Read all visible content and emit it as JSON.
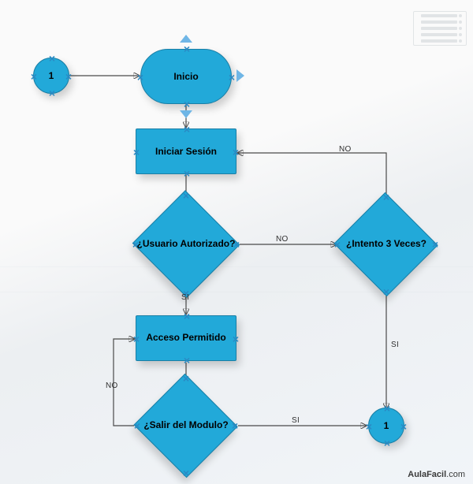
{
  "colors": {
    "shape_fill": "#22a9d9",
    "shape_stroke": "#1a7fa6",
    "arrow": "#4a4a4a",
    "handle": "#2a8ac4"
  },
  "selected_node": "inicio",
  "nodes": {
    "conn_in": {
      "type": "connector-circle",
      "label": "1"
    },
    "inicio": {
      "type": "terminator",
      "label": "Inicio"
    },
    "login": {
      "type": "process",
      "label": "Iniciar Sesión"
    },
    "auth": {
      "type": "decision",
      "label": "¿Usuario Autorizado?"
    },
    "retry": {
      "type": "decision",
      "label": "¿Intento 3 Veces?"
    },
    "allowed": {
      "type": "process",
      "label": "Acceso Permitido"
    },
    "exitq": {
      "type": "decision",
      "label": "¿Salir del Modulo?"
    },
    "conn_out": {
      "type": "connector-circle",
      "label": "1"
    }
  },
  "edges": {
    "conn_in_to_inicio": {
      "from": "conn_in",
      "to": "inicio",
      "label": ""
    },
    "inicio_to_login": {
      "from": "inicio",
      "to": "login",
      "label": ""
    },
    "login_to_auth": {
      "from": "login",
      "to": "auth",
      "label": ""
    },
    "auth_yes_to_allowed": {
      "from": "auth",
      "to": "allowed",
      "label": "SI"
    },
    "auth_no_to_retry": {
      "from": "auth",
      "to": "retry",
      "label": "NO"
    },
    "retry_no_to_login": {
      "from": "retry",
      "to": "login",
      "label": "NO"
    },
    "retry_yes_to_out": {
      "from": "retry",
      "to": "conn_out",
      "label": "SI"
    },
    "allowed_to_exitq": {
      "from": "allowed",
      "to": "exitq",
      "label": ""
    },
    "exitq_yes_to_out": {
      "from": "exitq",
      "to": "conn_out",
      "label": "SI"
    },
    "exitq_no_to_allowed": {
      "from": "exitq",
      "to": "allowed",
      "label": "NO"
    }
  },
  "watermark": {
    "brand": "AulaFacil",
    "suffix": ".com"
  }
}
